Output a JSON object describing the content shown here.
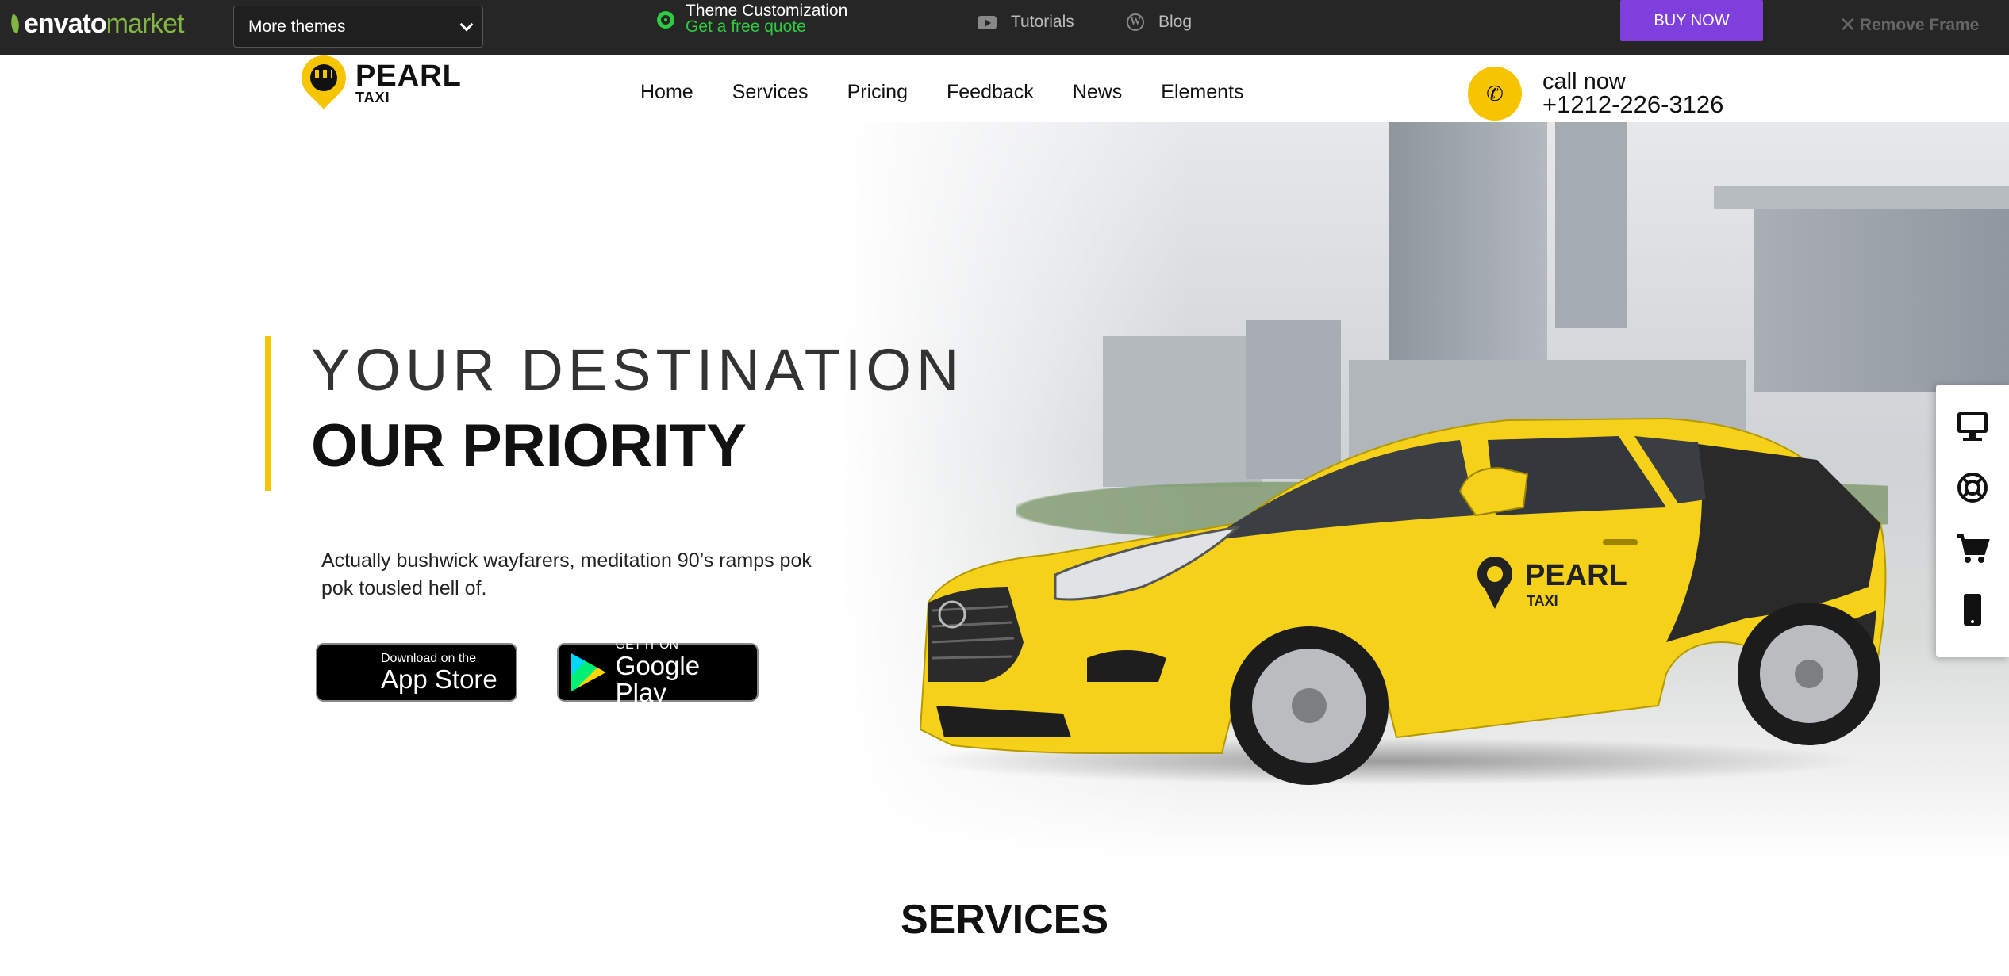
{
  "topbar": {
    "logo_part1": "envato",
    "logo_part2": "market",
    "more_themes": "More themes",
    "theme_customization": "Theme Customization",
    "free_quote": "Get a free quote",
    "tutorials": "Tutorials",
    "blog": "Blog",
    "buy_now": "BUY NOW",
    "remove_frame": "Remove Frame"
  },
  "header": {
    "logo_title": "PEARL",
    "logo_subtitle": "TAXI",
    "nav": [
      "Home",
      "Services",
      "Pricing",
      "Feedback",
      "News",
      "Elements"
    ],
    "call_label": "call now",
    "call_number": "+1212-226-3126"
  },
  "hero": {
    "line1": "YOUR DESTINATION",
    "line2": "OUR PRIORITY",
    "paragraph": "Actually bushwick wayfarers, meditation 90’s ramps pok pok tousled hell of.",
    "appstore_small": "Download on the",
    "appstore_big": "App Store",
    "googleplay_small": "GET IT ON",
    "googleplay_big": "Google Play",
    "car_logo_title": "PEARL",
    "car_logo_subtitle": "TAXI"
  },
  "side_panel": {
    "icons": [
      "desktop-icon",
      "lifebuoy-icon",
      "cart-icon",
      "mobile-icon"
    ]
  },
  "services_heading": "SERVICES",
  "colors": {
    "accent_yellow": "#f7c500",
    "topbar_bg": "#262626",
    "buy_purple": "#7e3fdc",
    "envato_green": "#82b541",
    "link_green": "#2ecc40"
  }
}
